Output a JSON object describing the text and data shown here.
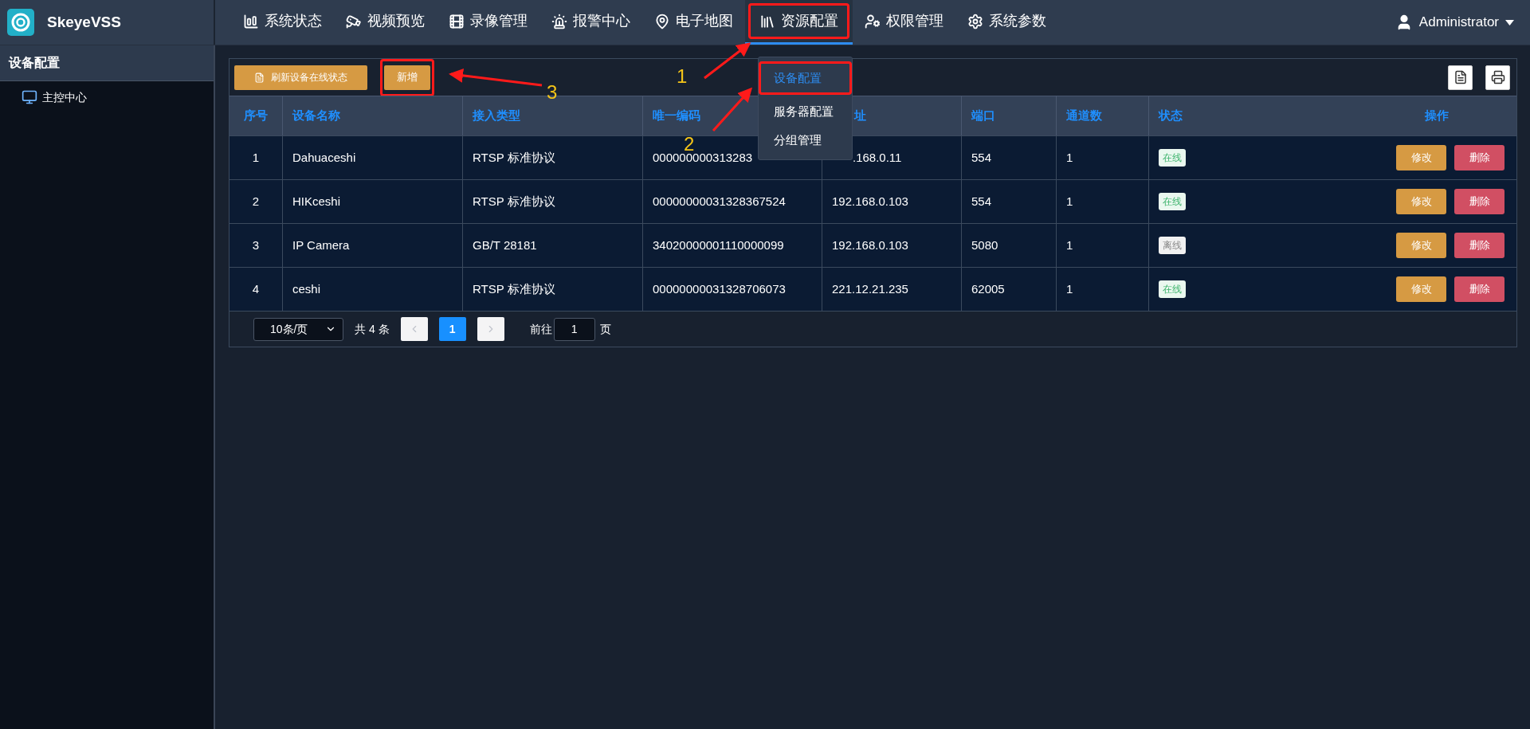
{
  "app": {
    "title": "SkeyeVSS"
  },
  "nav": [
    {
      "label": "系统状态",
      "selected": false
    },
    {
      "label": "视频预览",
      "selected": false
    },
    {
      "label": "录像管理",
      "selected": false
    },
    {
      "label": "报警中心",
      "selected": false
    },
    {
      "label": "电子地图",
      "selected": false
    },
    {
      "label": "资源配置",
      "selected": true
    },
    {
      "label": "权限管理",
      "selected": false
    },
    {
      "label": "系统参数",
      "selected": false
    }
  ],
  "user": {
    "name": "Administrator"
  },
  "dropdown": {
    "items": [
      {
        "label": "设备配置",
        "selected": true
      },
      {
        "label": "服务器配置",
        "selected": false
      },
      {
        "label": "分组管理",
        "selected": false
      }
    ]
  },
  "sidebar": {
    "title": "设备配置",
    "items": [
      {
        "label": "主控中心"
      }
    ]
  },
  "toolbar": {
    "refresh": "刷新设备在线状态",
    "add": "新增"
  },
  "table": {
    "columns": [
      "序号",
      "设备名称",
      "接入类型",
      "唯一编码",
      "址",
      "端口",
      "通道数",
      "状态",
      "操作"
    ],
    "rows": [
      {
        "cells": [
          "1",
          "Dahuaceshi",
          "RTSP 标准协议",
          "000000000313283",
          ".168.0.11",
          "554",
          "1"
        ],
        "status": {
          "label": "在线",
          "online": true
        },
        "actions": [
          "修改",
          "删除"
        ]
      },
      {
        "cells": [
          "2",
          "HIKceshi",
          "RTSP 标准协议",
          "00000000031328367524",
          "192.168.0.103",
          "554",
          "1"
        ],
        "status": {
          "label": "在线",
          "online": true
        },
        "actions": [
          "修改",
          "删除"
        ]
      },
      {
        "cells": [
          "3",
          "IP Camera",
          "GB/T 28181",
          "34020000001110000099",
          "192.168.0.103",
          "5080",
          "1"
        ],
        "status": {
          "label": "离线",
          "online": false
        },
        "actions": [
          "修改",
          "删除"
        ]
      },
      {
        "cells": [
          "4",
          "ceshi",
          "RTSP 标准协议",
          "00000000031328706073",
          "221.12.21.235",
          "62005",
          "1"
        ],
        "status": {
          "label": "在线",
          "online": true
        },
        "actions": [
          "修改",
          "删除"
        ]
      }
    ]
  },
  "pagination": {
    "page_size": "10条/页",
    "total": "共 4 条",
    "pages": [
      {
        "label": "1",
        "selected": true
      }
    ],
    "goto": "前往",
    "goto_value": "1",
    "page_suffix": "页"
  },
  "annotations": [
    {
      "label": "1"
    },
    {
      "label": "2"
    },
    {
      "label": "3"
    }
  ]
}
